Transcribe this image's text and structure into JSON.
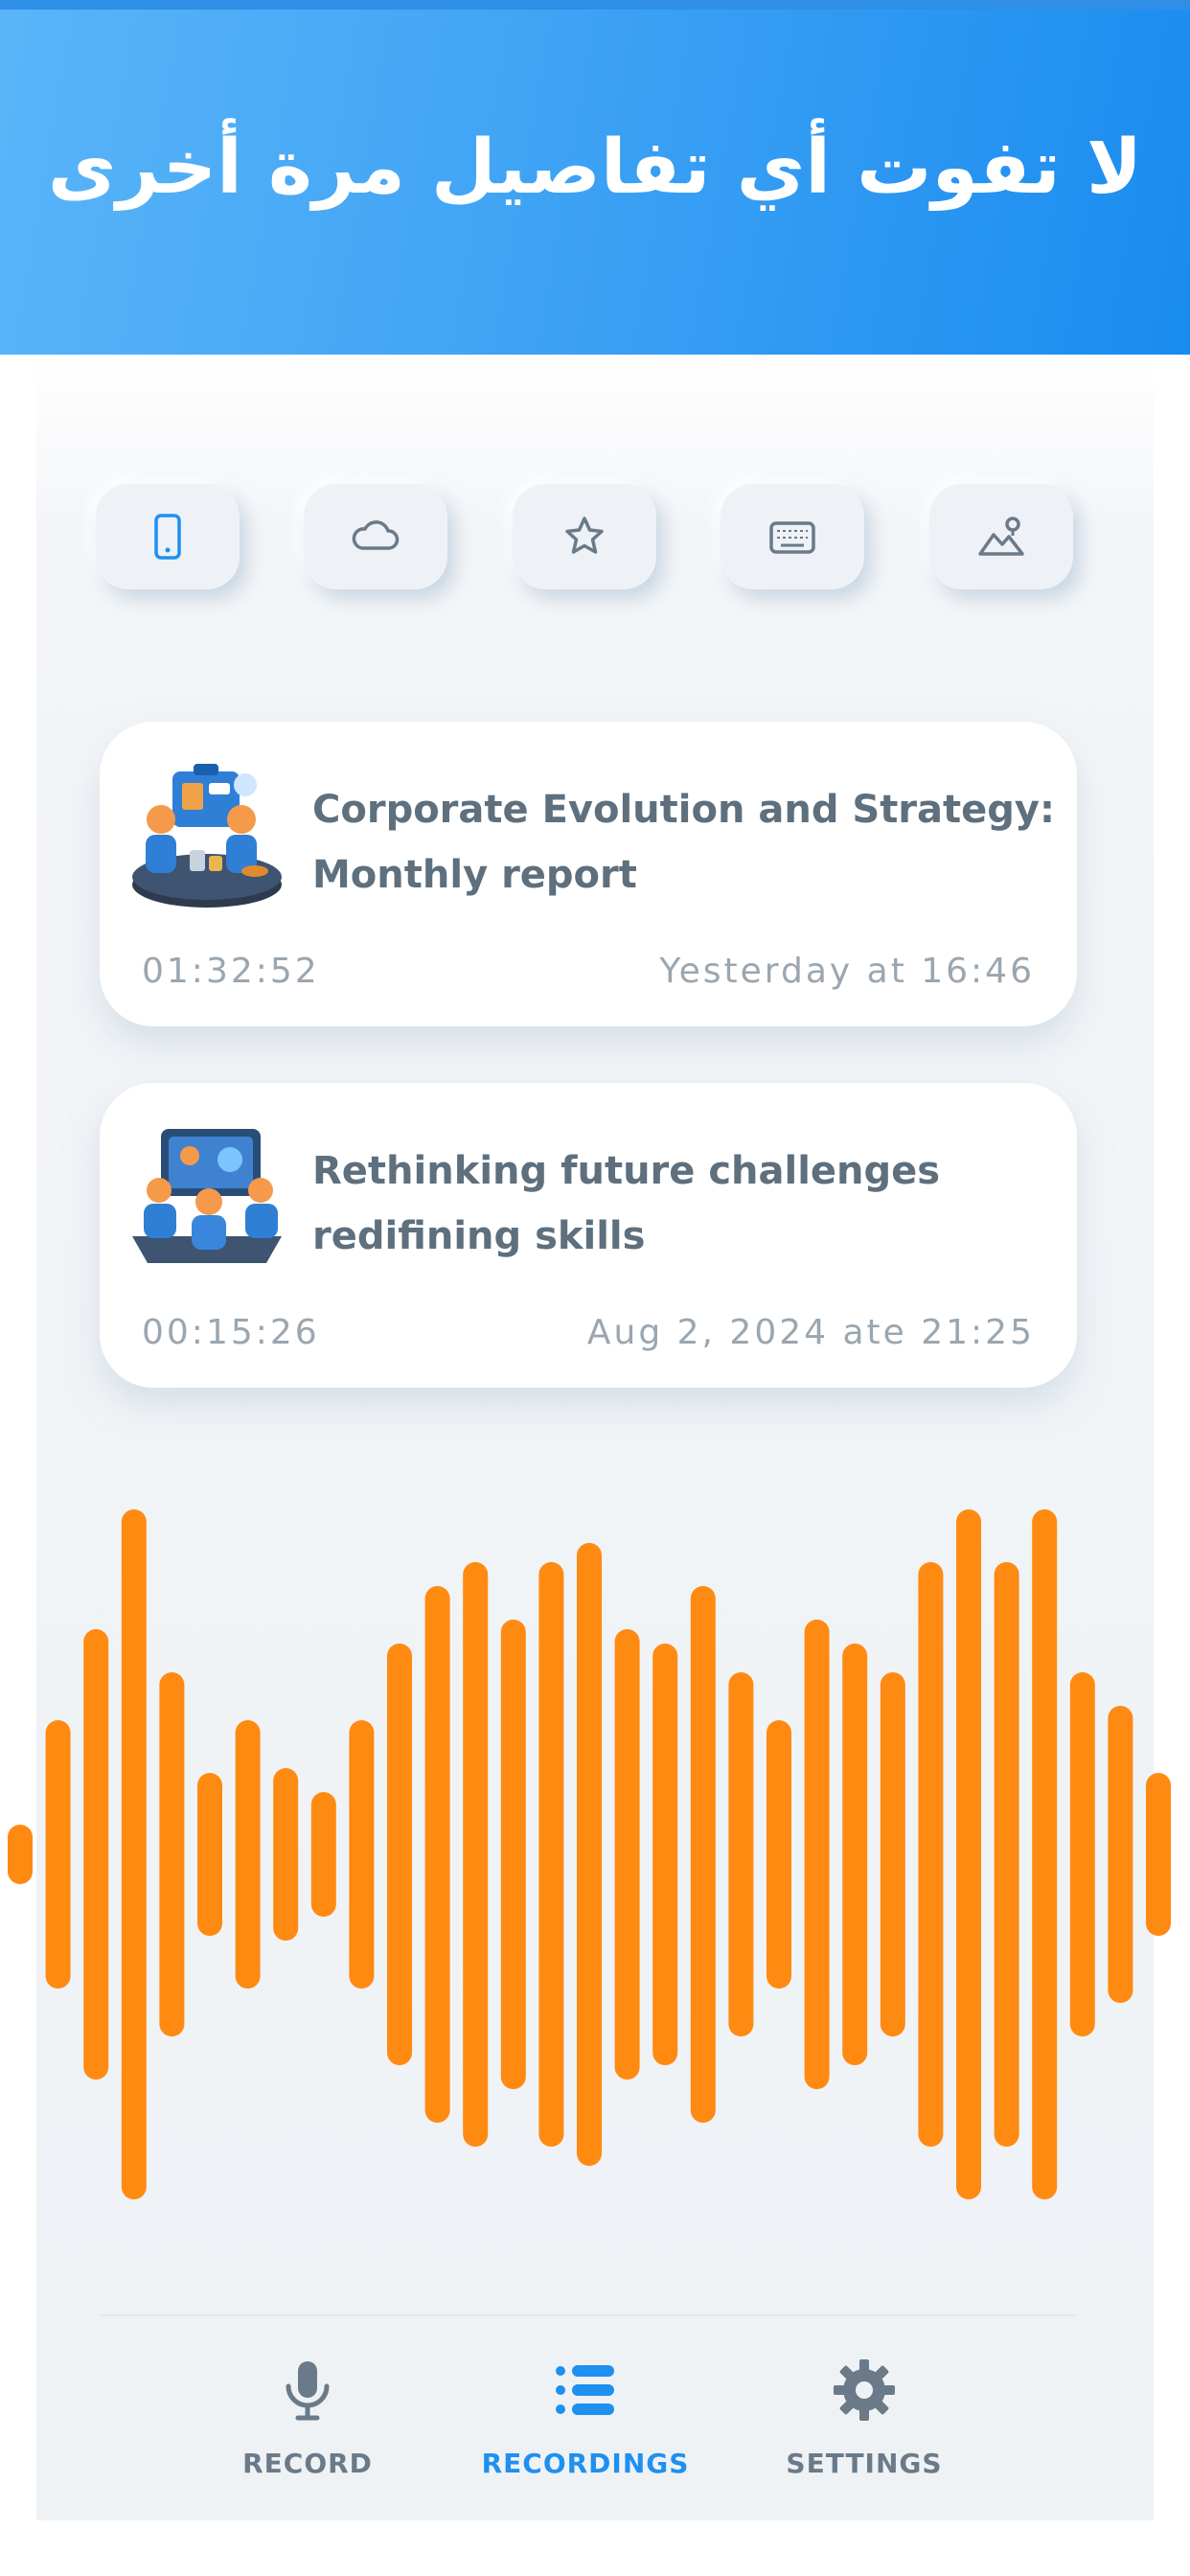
{
  "header": {
    "title": "لا تفوت أي تفاصيل مرة أخرى"
  },
  "colors": {
    "accent": "#1e90f0",
    "wave": "#ff8a12",
    "icon": "#6a7a88",
    "text": "#5e6f7d",
    "muted": "#9aa6b0"
  },
  "toolbar": {
    "buttons": [
      {
        "icon": "phone-icon",
        "active": true
      },
      {
        "icon": "cloud-icon",
        "active": false
      },
      {
        "icon": "star-icon",
        "active": false
      },
      {
        "icon": "keyboard-icon",
        "active": false
      },
      {
        "icon": "image-icon",
        "active": false
      }
    ]
  },
  "recordings": [
    {
      "title": "Corporate Evolution and Strategy: Monthly report",
      "duration": "01:32:52",
      "date": "Yesterday at 16:46",
      "thumbnail": "business-meeting-icon"
    },
    {
      "title": "Rethinking future challenges redifining skills",
      "duration": "00:15:26",
      "date": "Aug 2, 2024 ate 21:25",
      "thumbnail": "presentation-team-icon"
    }
  ],
  "nav": {
    "items": [
      {
        "label": "RECORD",
        "icon": "microphone-icon",
        "active": false
      },
      {
        "label": "RECORDINGS",
        "icon": "list-icon",
        "active": true
      },
      {
        "label": "SETTINGS",
        "icon": "gear-icon",
        "active": false
      }
    ]
  }
}
